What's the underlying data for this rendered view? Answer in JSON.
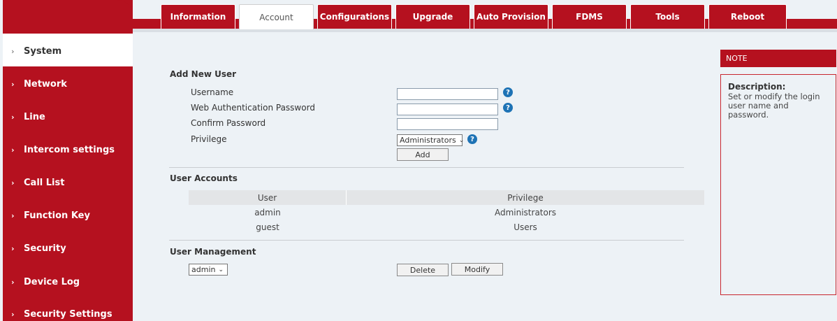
{
  "tabs": [
    {
      "label": "Information"
    },
    {
      "label": "Account"
    },
    {
      "label": "Configurations"
    },
    {
      "label": "Upgrade"
    },
    {
      "label": "Auto Provision"
    },
    {
      "label": "FDMS"
    },
    {
      "label": "Tools"
    },
    {
      "label": "Reboot"
    }
  ],
  "active_tab": "Account",
  "sidebar": {
    "items": [
      {
        "label": "System",
        "active": true
      },
      {
        "label": "Network"
      },
      {
        "label": "Line"
      },
      {
        "label": "Intercom settings"
      },
      {
        "label": "Call List"
      },
      {
        "label": "Function Key"
      },
      {
        "label": "Security"
      },
      {
        "label": "Device Log"
      },
      {
        "label": "Security Settings"
      }
    ],
    "chevron": "›"
  },
  "add_user": {
    "title": "Add New User",
    "username_label": "Username",
    "username_value": "",
    "password_label": "Web Authentication Password",
    "password_value": "",
    "confirm_label": "Confirm Password",
    "confirm_value": "",
    "privilege_label": "Privilege",
    "privilege_value": "Administrators",
    "add_button": "Add",
    "help_glyph": "?"
  },
  "user_accounts": {
    "title": "User Accounts",
    "columns": [
      "User",
      "Privilege"
    ],
    "rows": [
      {
        "user": "admin",
        "privilege": "Administrators"
      },
      {
        "user": "guest",
        "privilege": "Users"
      }
    ]
  },
  "user_management": {
    "title": "User Management",
    "selected_user": "admin",
    "delete_button": "Delete",
    "modify_button": "Modify"
  },
  "note": {
    "header": "NOTE",
    "desc_title": "Description:",
    "desc_text": "Set or modify the login user name and password."
  },
  "colors": {
    "brand_red": "#b5111f",
    "help_blue": "#1e73b5",
    "background": "#edf2f6"
  },
  "icons": {
    "caret": "⌄",
    "help": "help-icon"
  }
}
